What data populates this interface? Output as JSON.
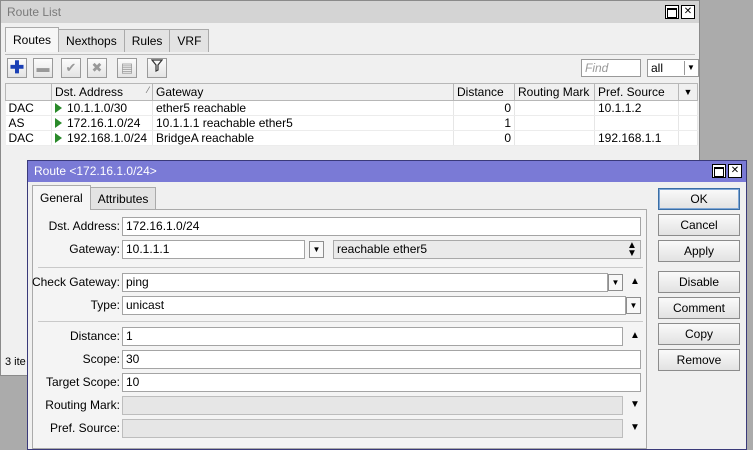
{
  "list_window": {
    "title": "Route List",
    "tabs": [
      "Routes",
      "Nexthops",
      "Rules",
      "VRF"
    ],
    "toolbar": {
      "add_icon": "plus-icon",
      "remove_icon": "minus-icon",
      "enable_icon": "check-icon",
      "disable_icon": "cross-icon",
      "comment_icon": "note-icon",
      "filter_icon": "funnel-icon",
      "find_placeholder": "Find",
      "filter_value": "all"
    },
    "columns": [
      "",
      "Dst. Address",
      "Gateway",
      "Distance",
      "Routing Mark",
      "Pref. Source"
    ],
    "rows": [
      {
        "flags": "DAC",
        "dst": "10.1.1.0/30",
        "gateway": "ether5 reachable",
        "distance": "0",
        "mark": "",
        "pref": "10.1.1.2"
      },
      {
        "flags": "AS",
        "dst": "172.16.1.0/24",
        "gateway": "10.1.1.1 reachable ether5",
        "distance": "1",
        "mark": "",
        "pref": ""
      },
      {
        "flags": "DAC",
        "dst": "192.168.1.0/24",
        "gateway": "BridgeA reachable",
        "distance": "0",
        "mark": "",
        "pref": "192.168.1.1"
      }
    ],
    "status": "3 ite"
  },
  "route_window": {
    "title": "Route <172.16.1.0/24>",
    "tabs": [
      "General",
      "Attributes"
    ],
    "fields": {
      "dst_label": "Dst. Address:",
      "dst_value": "172.16.1.0/24",
      "gw_label": "Gateway:",
      "gw_value": "10.1.1.1",
      "gw_state": "reachable ether5",
      "check_label": "Check Gateway:",
      "check_value": "ping",
      "type_label": "Type:",
      "type_value": "unicast",
      "distance_label": "Distance:",
      "distance_value": "1",
      "scope_label": "Scope:",
      "scope_value": "30",
      "target_label": "Target Scope:",
      "target_value": "10",
      "mark_label": "Routing Mark:",
      "mark_value": "",
      "pref_label": "Pref. Source:",
      "pref_value": ""
    },
    "buttons": [
      "OK",
      "Cancel",
      "Apply",
      "Disable",
      "Comment",
      "Copy",
      "Remove"
    ]
  },
  "colors": {
    "active_title": "#7a7ad6",
    "inactive_title": "#d4d4d4",
    "play_green": "#2a8a2a"
  }
}
